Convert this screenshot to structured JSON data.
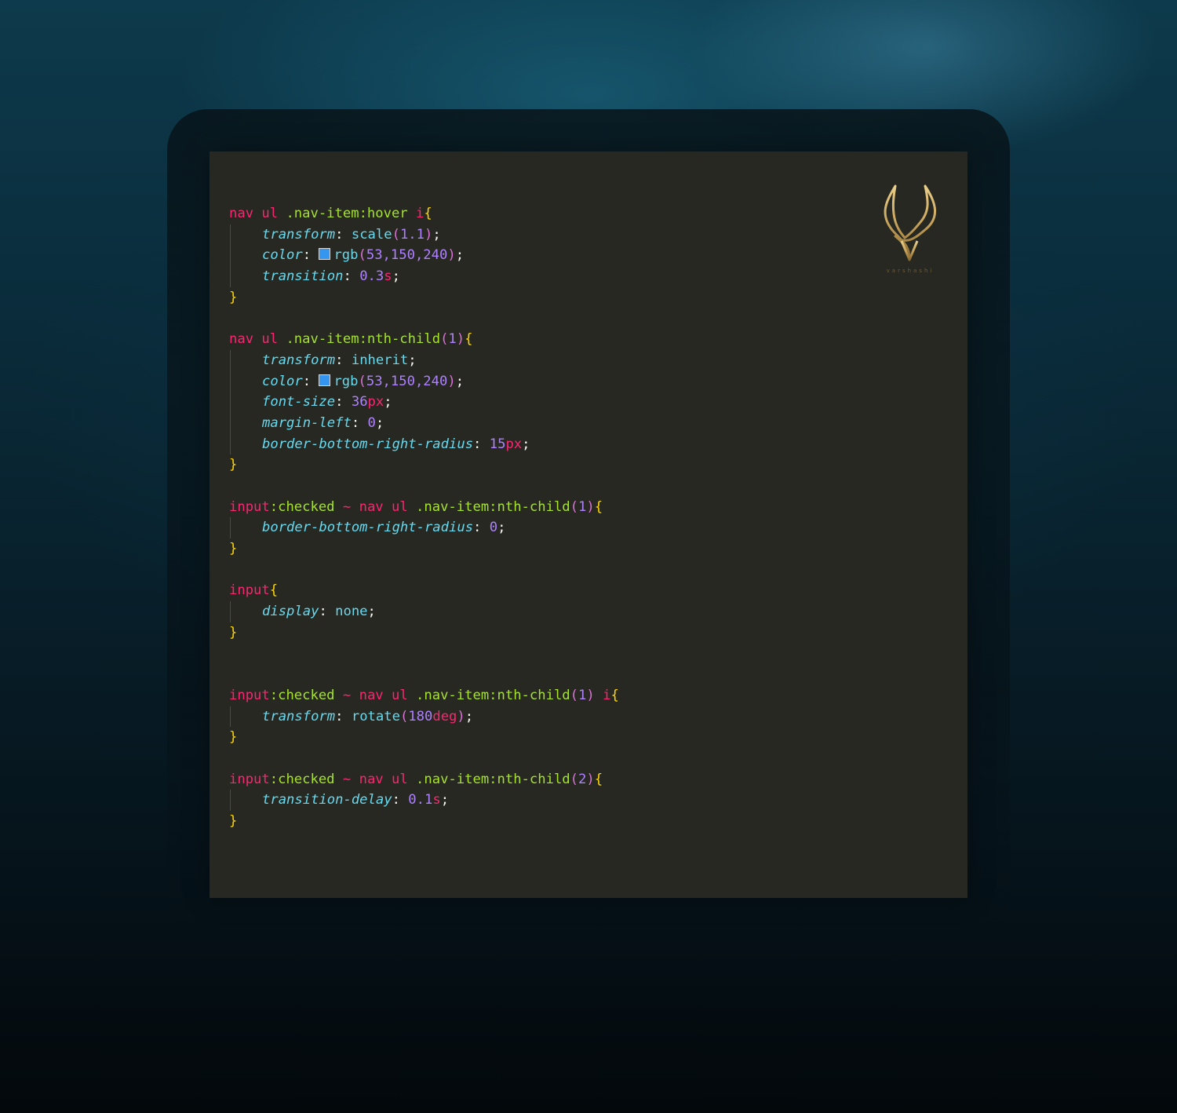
{
  "brand": {
    "logo_icon": "horns-logo-icon",
    "wordmark": "varshashi",
    "accent_color": "#c9a45c"
  },
  "editor": {
    "background_color": "#272822",
    "swatch_color": "#3596f0"
  },
  "code": {
    "r1": {
      "sel_tag": "nav ul",
      "sel_cls": " .nav-item:hover",
      "sel_el": " i",
      "open": "{",
      "l1_prop": "transform",
      "l1_func": "scale",
      "l1_paren_open": "(",
      "l1_num": "1.1",
      "l1_paren_close": ")",
      "l2_prop": "color",
      "l2_func": "rgb",
      "l2_paren_open": "(",
      "l2_num": "53,150,240",
      "l2_paren_close": ")",
      "l3_prop": "transition",
      "l3_num": "0.3",
      "l3_unit": "s",
      "close": "}"
    },
    "r2": {
      "sel_tag": "nav ul",
      "sel_cls": " .nav-item:nth-child",
      "paren_open": "(",
      "arg": "1",
      "paren_close": ")",
      "open": "{",
      "l1_prop": "transform",
      "l1_val": "inherit",
      "l2_prop": "color",
      "l2_func": "rgb",
      "l2_paren_open": "(",
      "l2_num": "53,150,240",
      "l2_paren_close": ")",
      "l3_prop": "font-size",
      "l3_num": "36",
      "l3_unit": "px",
      "l4_prop": "margin-left",
      "l4_num": "0",
      "l5_prop": "border-bottom-right-radius",
      "l5_num": "15",
      "l5_unit": "px",
      "close": "}"
    },
    "r3": {
      "sel_tag": "input",
      "sel_pseudo": ":checked",
      "sel_comb": " ~ ",
      "sel_tag2": "nav ul",
      "sel_cls": " .nav-item:nth-child",
      "paren_open": "(",
      "arg": "1",
      "paren_close": ")",
      "open": "{",
      "l1_prop": "border-bottom-right-radius",
      "l1_num": "0",
      "close": "}"
    },
    "r4": {
      "sel_tag": "input",
      "open": "{",
      "l1_prop": "display",
      "l1_val": "none",
      "close": "}"
    },
    "r5": {
      "sel_tag": "input",
      "sel_pseudo": ":checked",
      "sel_comb": " ~ ",
      "sel_tag2": "nav ul",
      "sel_cls": " .nav-item:nth-child",
      "paren_open": "(",
      "arg": "1",
      "paren_close": ")",
      "sel_el": " i",
      "open": "{",
      "l1_prop": "transform",
      "l1_func": "rotate",
      "l1_paren_open": "(",
      "l1_num": "180",
      "l1_unit": "deg",
      "l1_paren_close": ")",
      "close": "}"
    },
    "r6": {
      "sel_tag": "input",
      "sel_pseudo": ":checked",
      "sel_comb": " ~ ",
      "sel_tag2": "nav ul",
      "sel_cls": " .nav-item:nth-child",
      "paren_open": "(",
      "arg": "2",
      "paren_close": ")",
      "open": "{",
      "l1_prop": "transition-delay",
      "l1_num": "0.1",
      "l1_unit": "s",
      "close": "}"
    },
    "punct": {
      "colon": ": ",
      "semi": ";"
    }
  }
}
